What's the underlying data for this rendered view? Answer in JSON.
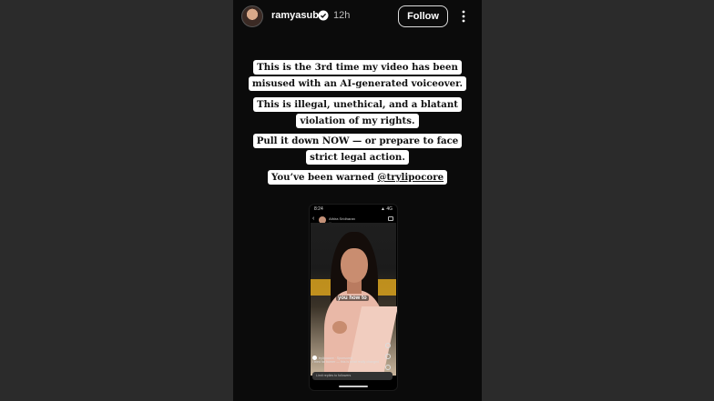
{
  "story": {
    "username": "ramyasub",
    "time": "12h",
    "follow_label": "Follow",
    "captions": [
      [
        "This is the 3rd time my video has been",
        "misused with an AI-generated voiceover."
      ],
      [
        "This is illegal, unethical, and a blatant",
        "violation of my rights."
      ],
      [
        "Pull it down NOW — or prepare to face",
        "strict legal action."
      ]
    ],
    "warning_prefix": "You’ve been warned ",
    "warning_mention": "@trylipocore"
  },
  "embedded_screenshot": {
    "status_time": "8:24",
    "status_right": "▲ 4G",
    "account_name": "Athira Sridharan",
    "account_time": "1h ago",
    "subtitle": "you how to",
    "bottom_account": "trylipocore · Sponsored",
    "bottom_caption": "I tried fat burner — this is what really changed",
    "reply_placeholder": "Limit replies to followers"
  },
  "colors": {
    "story_bg": "#0b0b0b",
    "side_bg": "#2b2b2b",
    "caption_bg": "#ffffff",
    "verified_blue": "#3897f0"
  }
}
